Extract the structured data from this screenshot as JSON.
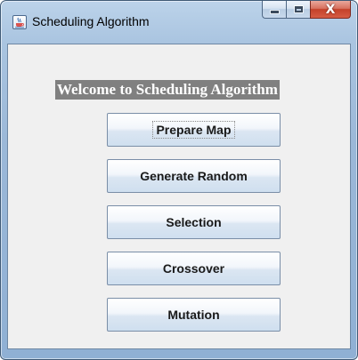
{
  "window": {
    "title": "Scheduling Algorithm"
  },
  "caption": {
    "minimize_icon": "minimize-icon",
    "maximize_icon": "maximize-icon",
    "close_glyph": "X"
  },
  "main": {
    "welcome_text": "Welcome to Scheduling Algorithm",
    "buttons": [
      {
        "label": "Prepare Map"
      },
      {
        "label": "Generate Random"
      },
      {
        "label": "Selection"
      },
      {
        "label": "Crossover"
      },
      {
        "label": "Mutation"
      }
    ]
  },
  "colors": {
    "frame": "#9bb8d8",
    "client_bg": "#f0f0f0",
    "welcome_bg": "#808080",
    "close_button": "#c4412a"
  }
}
